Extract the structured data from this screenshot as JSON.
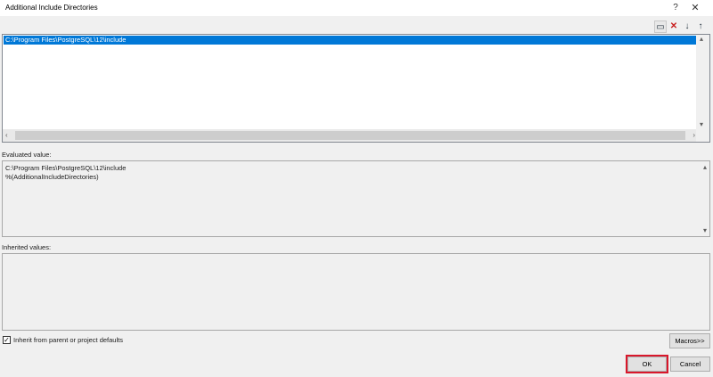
{
  "window": {
    "title": "Additional Include Directories",
    "help_glyph": "?",
    "close_glyph": "✕"
  },
  "toolbar": {
    "new_line_icon": "new-line-icon",
    "delete_icon": "delete-icon",
    "move_down_icon": "move-down-icon",
    "move_up_icon": "move-up-icon",
    "new_line_glyph": "▭",
    "delete_glyph": "✕",
    "move_down_glyph": "↓",
    "move_up_glyph": "↑"
  },
  "list": {
    "items": [
      "C:\\Program Files\\PostgreSQL\\12\\include"
    ],
    "selected_index": 0,
    "selection_color": "#0078d7"
  },
  "evaluated": {
    "label": "Evaluated value:",
    "lines": [
      "C:\\Program Files\\PostgreSQL\\12\\include",
      "%(AdditionalIncludeDirectories)"
    ]
  },
  "inherited": {
    "label": "Inherited values:"
  },
  "inherit_checkbox": {
    "label": "Inherit from parent or project defaults",
    "checked": true,
    "check_glyph": "✓"
  },
  "buttons": {
    "macros": "Macros>>",
    "ok": "OK",
    "cancel": "Cancel"
  },
  "highlight_color": "#d9172b"
}
